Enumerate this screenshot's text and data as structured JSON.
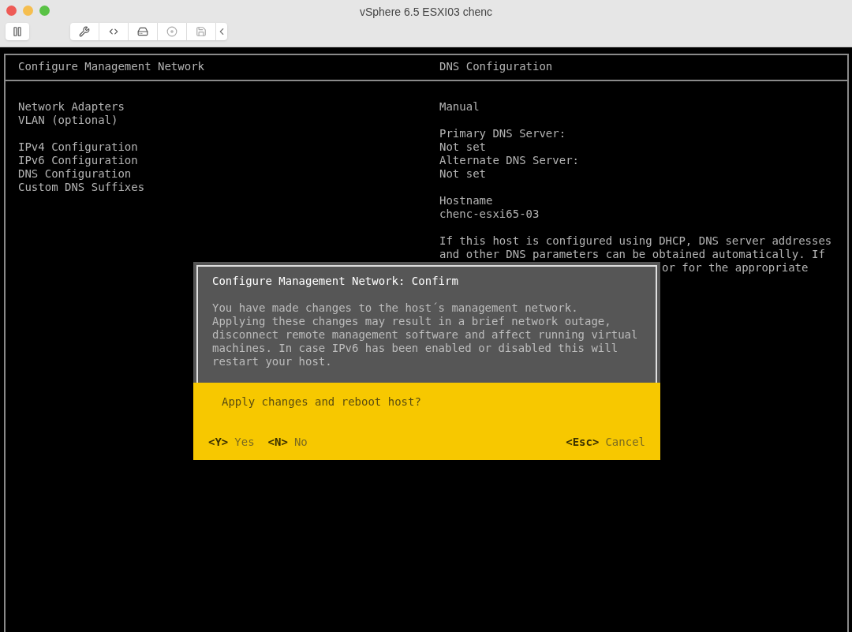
{
  "window": {
    "title": "vSphere 6.5 ESXI03 chenc"
  },
  "left_panel": {
    "title": "Configure Management Network",
    "groups": [
      [
        "Network Adapters",
        "VLAN (optional)"
      ],
      [
        "IPv4 Configuration",
        "IPv6 Configuration",
        "DNS Configuration",
        "Custom DNS Suffixes"
      ]
    ]
  },
  "right_panel": {
    "title": "DNS Configuration",
    "groups": [
      [
        "Manual"
      ],
      [
        "Primary DNS Server:",
        "Not set",
        "Alternate DNS Server:",
        "Not set"
      ],
      [
        "Hostname",
        "chenc-esxi65-03"
      ]
    ],
    "description": [
      {
        "kind": "full",
        "text": "If this host is configured using DHCP, DNS server addresses"
      },
      {
        "kind": "full",
        "text": "and other DNS parameters can be obtained automatically. If"
      },
      {
        "kind": "partial",
        "text": "or for the appropriate"
      }
    ]
  },
  "dialog": {
    "title": "Configure Management Network: Confirm",
    "message": [
      "You have made changes to the host´s management network.",
      "Applying these changes may result in a brief network outage,",
      "disconnect remote management software and affect running virtual",
      "machines. In case IPv6 has been enabled or disabled this will",
      "restart your host."
    ],
    "question": "Apply changes and reboot host?",
    "actions_left": [
      {
        "key": "<Y>",
        "label": "Yes"
      },
      {
        "key": "<N>",
        "label": "No"
      }
    ],
    "actions_right": [
      {
        "key": "<Esc>",
        "label": "Cancel"
      }
    ]
  }
}
